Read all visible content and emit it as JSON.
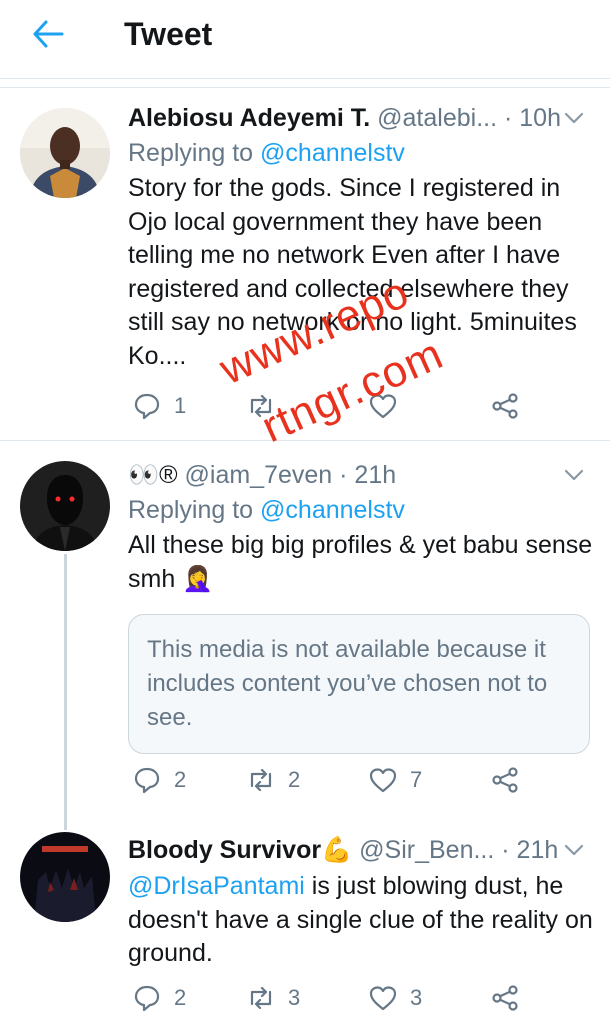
{
  "header": {
    "title": "Tweet"
  },
  "tweets": [
    {
      "name": "Alebiosu Adeyemi T.",
      "handle": "@atalebi...",
      "time": "· 10h",
      "replying_prefix": "Replying to ",
      "replying_to": "@channelstv",
      "text": "Story for the gods. Since I registered in Ojo local government they have been telling me no network Even after I have registered and collected elsewhere they still say no network or no light. 5minuites Ko....",
      "replies": "1",
      "retweets": "",
      "likes": ""
    },
    {
      "name": "👀®",
      "handle": "@iam_7even",
      "time": "· 21h",
      "replying_prefix": "Replying to ",
      "replying_to": "@channelstv",
      "text": "All these big big profiles & yet babu sense smh 🤦‍♀️",
      "media_notice": "This media is not available because it includes content you’ve chosen not to see.",
      "replies": "2",
      "retweets": "2",
      "likes": "7"
    },
    {
      "name": "Bloody Survivor💪",
      "handle": "@Sir_Ben...",
      "time": "· 21h",
      "mention": "@DrIsaPantami",
      "text": " is just blowing dust, he doesn't have a single clue of the reality on ground.",
      "replies": "2",
      "retweets": "3",
      "likes": "3"
    }
  ],
  "watermark": {
    "line1": "www.repo",
    "line2": "rtngr.com"
  },
  "colors": {
    "accent": "#1da1f2",
    "muted": "#657786",
    "text": "#14171a",
    "watermark": "#e8321e"
  }
}
